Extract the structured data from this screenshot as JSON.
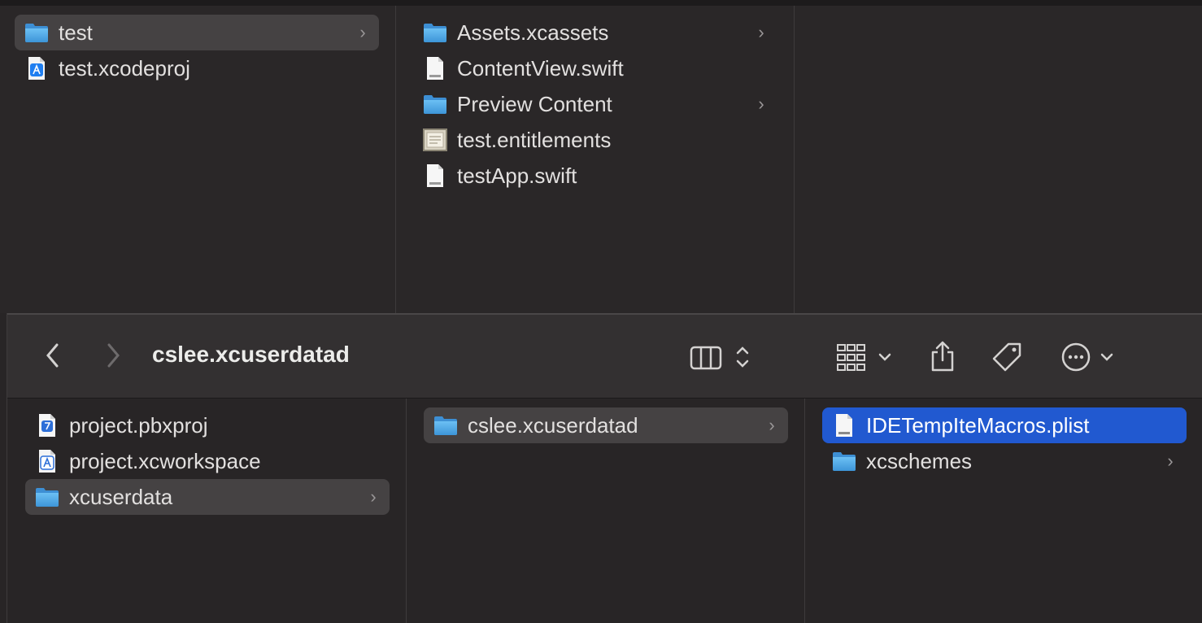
{
  "top_window": {
    "columns": [
      {
        "items": [
          {
            "label": "test",
            "icon": "folder-icon",
            "has_children": true,
            "selected": true
          },
          {
            "label": "test.xcodeproj",
            "icon": "xcodeproj-icon",
            "has_children": false,
            "selected": false
          }
        ]
      },
      {
        "items": [
          {
            "label": "Assets.xcassets",
            "icon": "folder-icon",
            "has_children": true
          },
          {
            "label": "ContentView.swift",
            "icon": "swift-file-icon",
            "has_children": false
          },
          {
            "label": "Preview Content",
            "icon": "folder-icon",
            "has_children": true
          },
          {
            "label": "test.entitlements",
            "icon": "entitlements-file-icon",
            "has_children": false
          },
          {
            "label": "testApp.swift",
            "icon": "swift-file-icon",
            "has_children": false
          }
        ]
      },
      {
        "items": []
      }
    ]
  },
  "bottom_window": {
    "toolbar": {
      "title": "cslee.xcuserdatad",
      "back": "chevron-left-icon",
      "forward": "chevron-right-icon",
      "view_mode": "columns-view-icon",
      "group": "grid-group-icon",
      "share": "share-icon",
      "tag": "tag-icon",
      "more": "ellipsis-circle-icon"
    },
    "columns": [
      {
        "items": [
          {
            "label": "project.pbxproj",
            "icon": "pbxproj-file-icon",
            "has_children": false
          },
          {
            "label": "project.xcworkspace",
            "icon": "xcworkspace-icon",
            "has_children": false
          },
          {
            "label": "xcuserdata",
            "icon": "folder-icon",
            "has_children": true,
            "selected": true
          }
        ]
      },
      {
        "items": [
          {
            "label": "cslee.xcuserdatad",
            "icon": "folder-icon",
            "has_children": true,
            "selected": true
          }
        ]
      },
      {
        "items": [
          {
            "label": "IDETempIteMacros.plist",
            "icon": "plist-file-icon",
            "has_children": false,
            "selected": true
          },
          {
            "label": "xcschemes",
            "icon": "folder-icon",
            "has_children": true
          }
        ]
      }
    ]
  },
  "glyphs": {
    "chevron": "›"
  },
  "colors": {
    "selection_blue": "#2159d0",
    "selection_gray": "#454243",
    "folder_blue": "#5aa9e6"
  }
}
